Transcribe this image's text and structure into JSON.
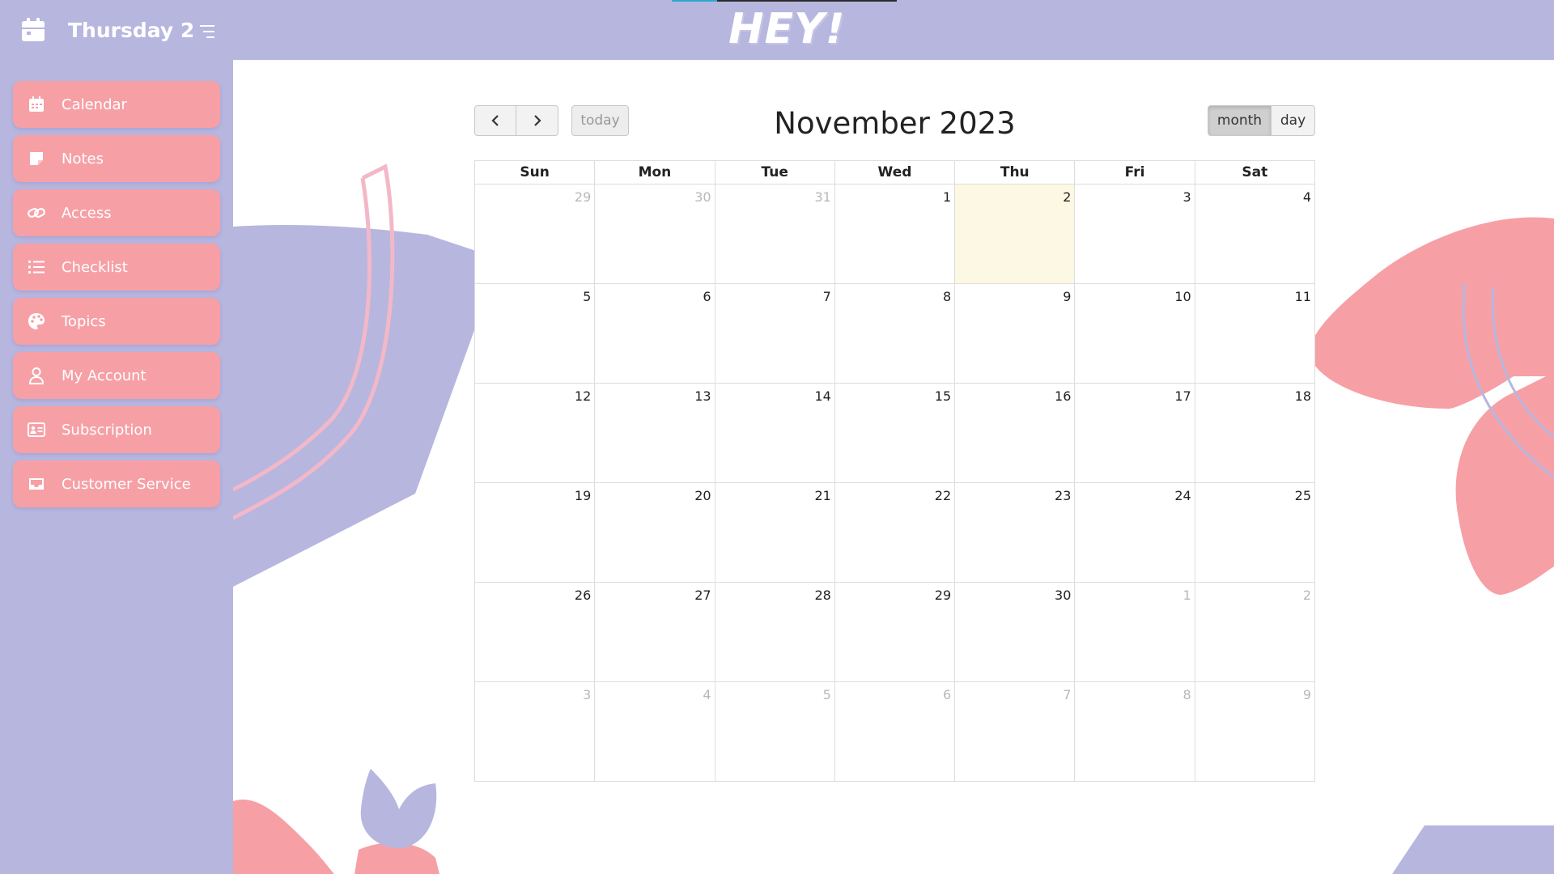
{
  "app": {
    "title": "Thursday 2",
    "logo_text": "HEY!"
  },
  "sidebar": {
    "items": [
      {
        "label": "Calendar",
        "icon": "calendar-icon"
      },
      {
        "label": "Notes",
        "icon": "note-icon"
      },
      {
        "label": "Access",
        "icon": "link-icon"
      },
      {
        "label": "Checklist",
        "icon": "list-icon"
      },
      {
        "label": "Topics",
        "icon": "palette-icon"
      },
      {
        "label": "My Account",
        "icon": "user-icon"
      },
      {
        "label": "Subscription",
        "icon": "id-card-icon"
      },
      {
        "label": "Customer Service",
        "icon": "inbox-icon"
      }
    ]
  },
  "calendar": {
    "title": "November 2023",
    "today_label": "today",
    "view_buttons": {
      "month": "month",
      "day": "day"
    },
    "active_view": "month",
    "weekdays": [
      "Sun",
      "Mon",
      "Tue",
      "Wed",
      "Thu",
      "Fri",
      "Sat"
    ],
    "weeks": [
      [
        {
          "d": "29",
          "o": true
        },
        {
          "d": "30",
          "o": true
        },
        {
          "d": "31",
          "o": true
        },
        {
          "d": "1"
        },
        {
          "d": "2",
          "today": true
        },
        {
          "d": "3"
        },
        {
          "d": "4"
        }
      ],
      [
        {
          "d": "5"
        },
        {
          "d": "6"
        },
        {
          "d": "7"
        },
        {
          "d": "8"
        },
        {
          "d": "9"
        },
        {
          "d": "10"
        },
        {
          "d": "11"
        }
      ],
      [
        {
          "d": "12"
        },
        {
          "d": "13"
        },
        {
          "d": "14"
        },
        {
          "d": "15"
        },
        {
          "d": "16"
        },
        {
          "d": "17"
        },
        {
          "d": "18"
        }
      ],
      [
        {
          "d": "19"
        },
        {
          "d": "20"
        },
        {
          "d": "21"
        },
        {
          "d": "22"
        },
        {
          "d": "23"
        },
        {
          "d": "24"
        },
        {
          "d": "25"
        }
      ],
      [
        {
          "d": "26"
        },
        {
          "d": "27"
        },
        {
          "d": "28"
        },
        {
          "d": "29"
        },
        {
          "d": "30"
        },
        {
          "d": "1",
          "o": true
        },
        {
          "d": "2",
          "o": true
        }
      ],
      [
        {
          "d": "3",
          "o": true
        },
        {
          "d": "4",
          "o": true
        },
        {
          "d": "5",
          "o": true
        },
        {
          "d": "6",
          "o": true
        },
        {
          "d": "7",
          "o": true
        },
        {
          "d": "8",
          "o": true
        },
        {
          "d": "9",
          "o": true
        }
      ]
    ]
  },
  "colors": {
    "sidebar_bg": "#b7b6df",
    "nav_item_bg": "#f6a0a6",
    "today_bg": "#fcf8e3",
    "deco_lilac": "#b7b6df",
    "deco_pink": "#f6a0a6"
  }
}
